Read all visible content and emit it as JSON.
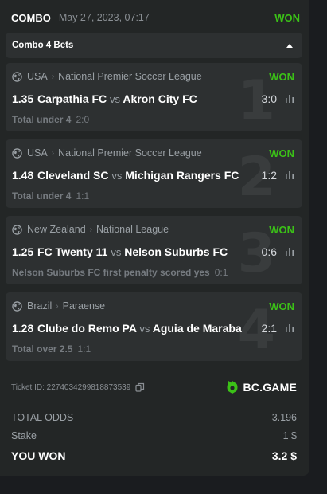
{
  "header": {
    "type": "COMBO",
    "datetime": "May 27, 2023, 07:17",
    "status": "WON"
  },
  "combo_bar": {
    "label": "Combo 4 Bets"
  },
  "bets": [
    {
      "index": "1",
      "country": "USA",
      "league": "National Premier Soccer League",
      "status": "WON",
      "odds": "1.35",
      "home": "Carpathia FC",
      "vs": "vs",
      "away": "Akron City FC",
      "score": "3:0",
      "market": "Total under 4",
      "selection": "2:0"
    },
    {
      "index": "2",
      "country": "USA",
      "league": "National Premier Soccer League",
      "status": "WON",
      "odds": "1.48",
      "home": "Cleveland SC",
      "vs": "vs",
      "away": "Michigan Rangers FC",
      "score": "1:2",
      "market": "Total under 4",
      "selection": "1:1"
    },
    {
      "index": "3",
      "country": "New Zealand",
      "league": "National League",
      "status": "WON",
      "odds": "1.25",
      "home": "FC Twenty 11",
      "vs": "vs",
      "away": "Nelson Suburbs FC",
      "score": "0:6",
      "market": "Nelson Suburbs FC first penalty scored yes",
      "selection": "0:1"
    },
    {
      "index": "4",
      "country": "Brazil",
      "league": "Paraense",
      "status": "WON",
      "odds": "1.28",
      "home": "Clube do Remo PA",
      "vs": "vs",
      "away": "Aguia de Maraba",
      "score": "2:1",
      "market": "Total over 2.5",
      "selection": "1:1"
    }
  ],
  "ticket": {
    "id_text": "Ticket ID: 227403429981887353​9",
    "logo": "BC.GAME"
  },
  "summary": {
    "total_odds_label": "TOTAL ODDS",
    "total_odds_value": "3.196",
    "stake_label": "Stake",
    "stake_value": "1 $",
    "won_label": "YOU WON",
    "won_value": "3.2 $"
  },
  "colors": {
    "won": "#3bc117",
    "background": "#1a1c1f",
    "card": "#232626",
    "panel": "#2d3031"
  },
  "icons": {
    "globe": "globe-icon",
    "stats": "stats-bars-icon",
    "copy": "copy-icon",
    "collapse": "caret-up-icon",
    "logo": "bc-game-logo-icon"
  }
}
